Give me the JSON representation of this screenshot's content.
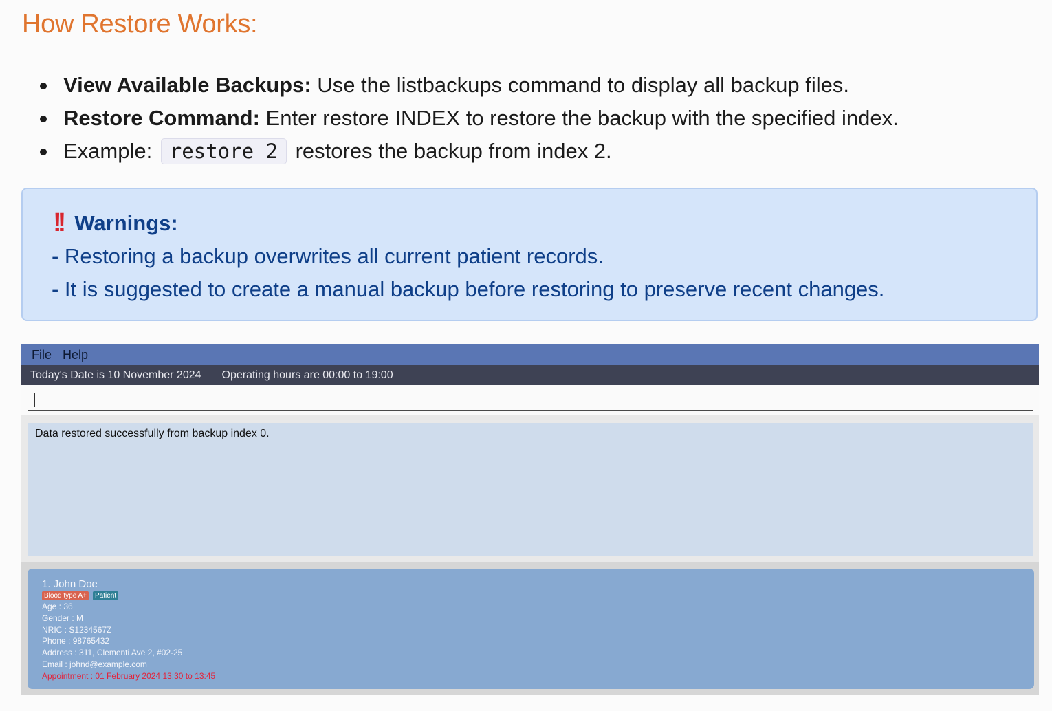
{
  "heading": "How Restore Works:",
  "steps": [
    {
      "bold": "View Available Backups:",
      "text": " Use the listbackups command to display all backup files."
    },
    {
      "bold": "Restore Command:",
      "text": " Enter restore INDEX to restore the backup with the specified index."
    },
    {
      "prefix": "Example: ",
      "code": "restore 2",
      "text": " restores the backup from index 2."
    }
  ],
  "warning": {
    "title": "Warnings:",
    "lines": [
      "- Restoring a backup overwrites all current patient records.",
      "- It is suggested to create a manual backup before restoring to preserve recent changes."
    ]
  },
  "app": {
    "menu": [
      "File",
      "Help"
    ],
    "status": {
      "date": "Today's Date is 10 November 2024",
      "hours": "Operating hours are 00:00 to 19:00"
    },
    "command_input": "",
    "result": "Data restored successfully from backup index 0.",
    "patients": [
      {
        "name": "1. John Doe",
        "tags": [
          "Blood type A+",
          "Patient"
        ],
        "age": "Age : 36",
        "gender": "Gender : M",
        "nric": "NRIC : S1234567Z",
        "phone": "Phone : 98765432",
        "address": "Address : 311, Clementi Ave 2, #02-25",
        "email": "Email : johnd@example.com",
        "appointment": "Appointment : 01 February 2024 13:30 to 13:45"
      }
    ]
  }
}
